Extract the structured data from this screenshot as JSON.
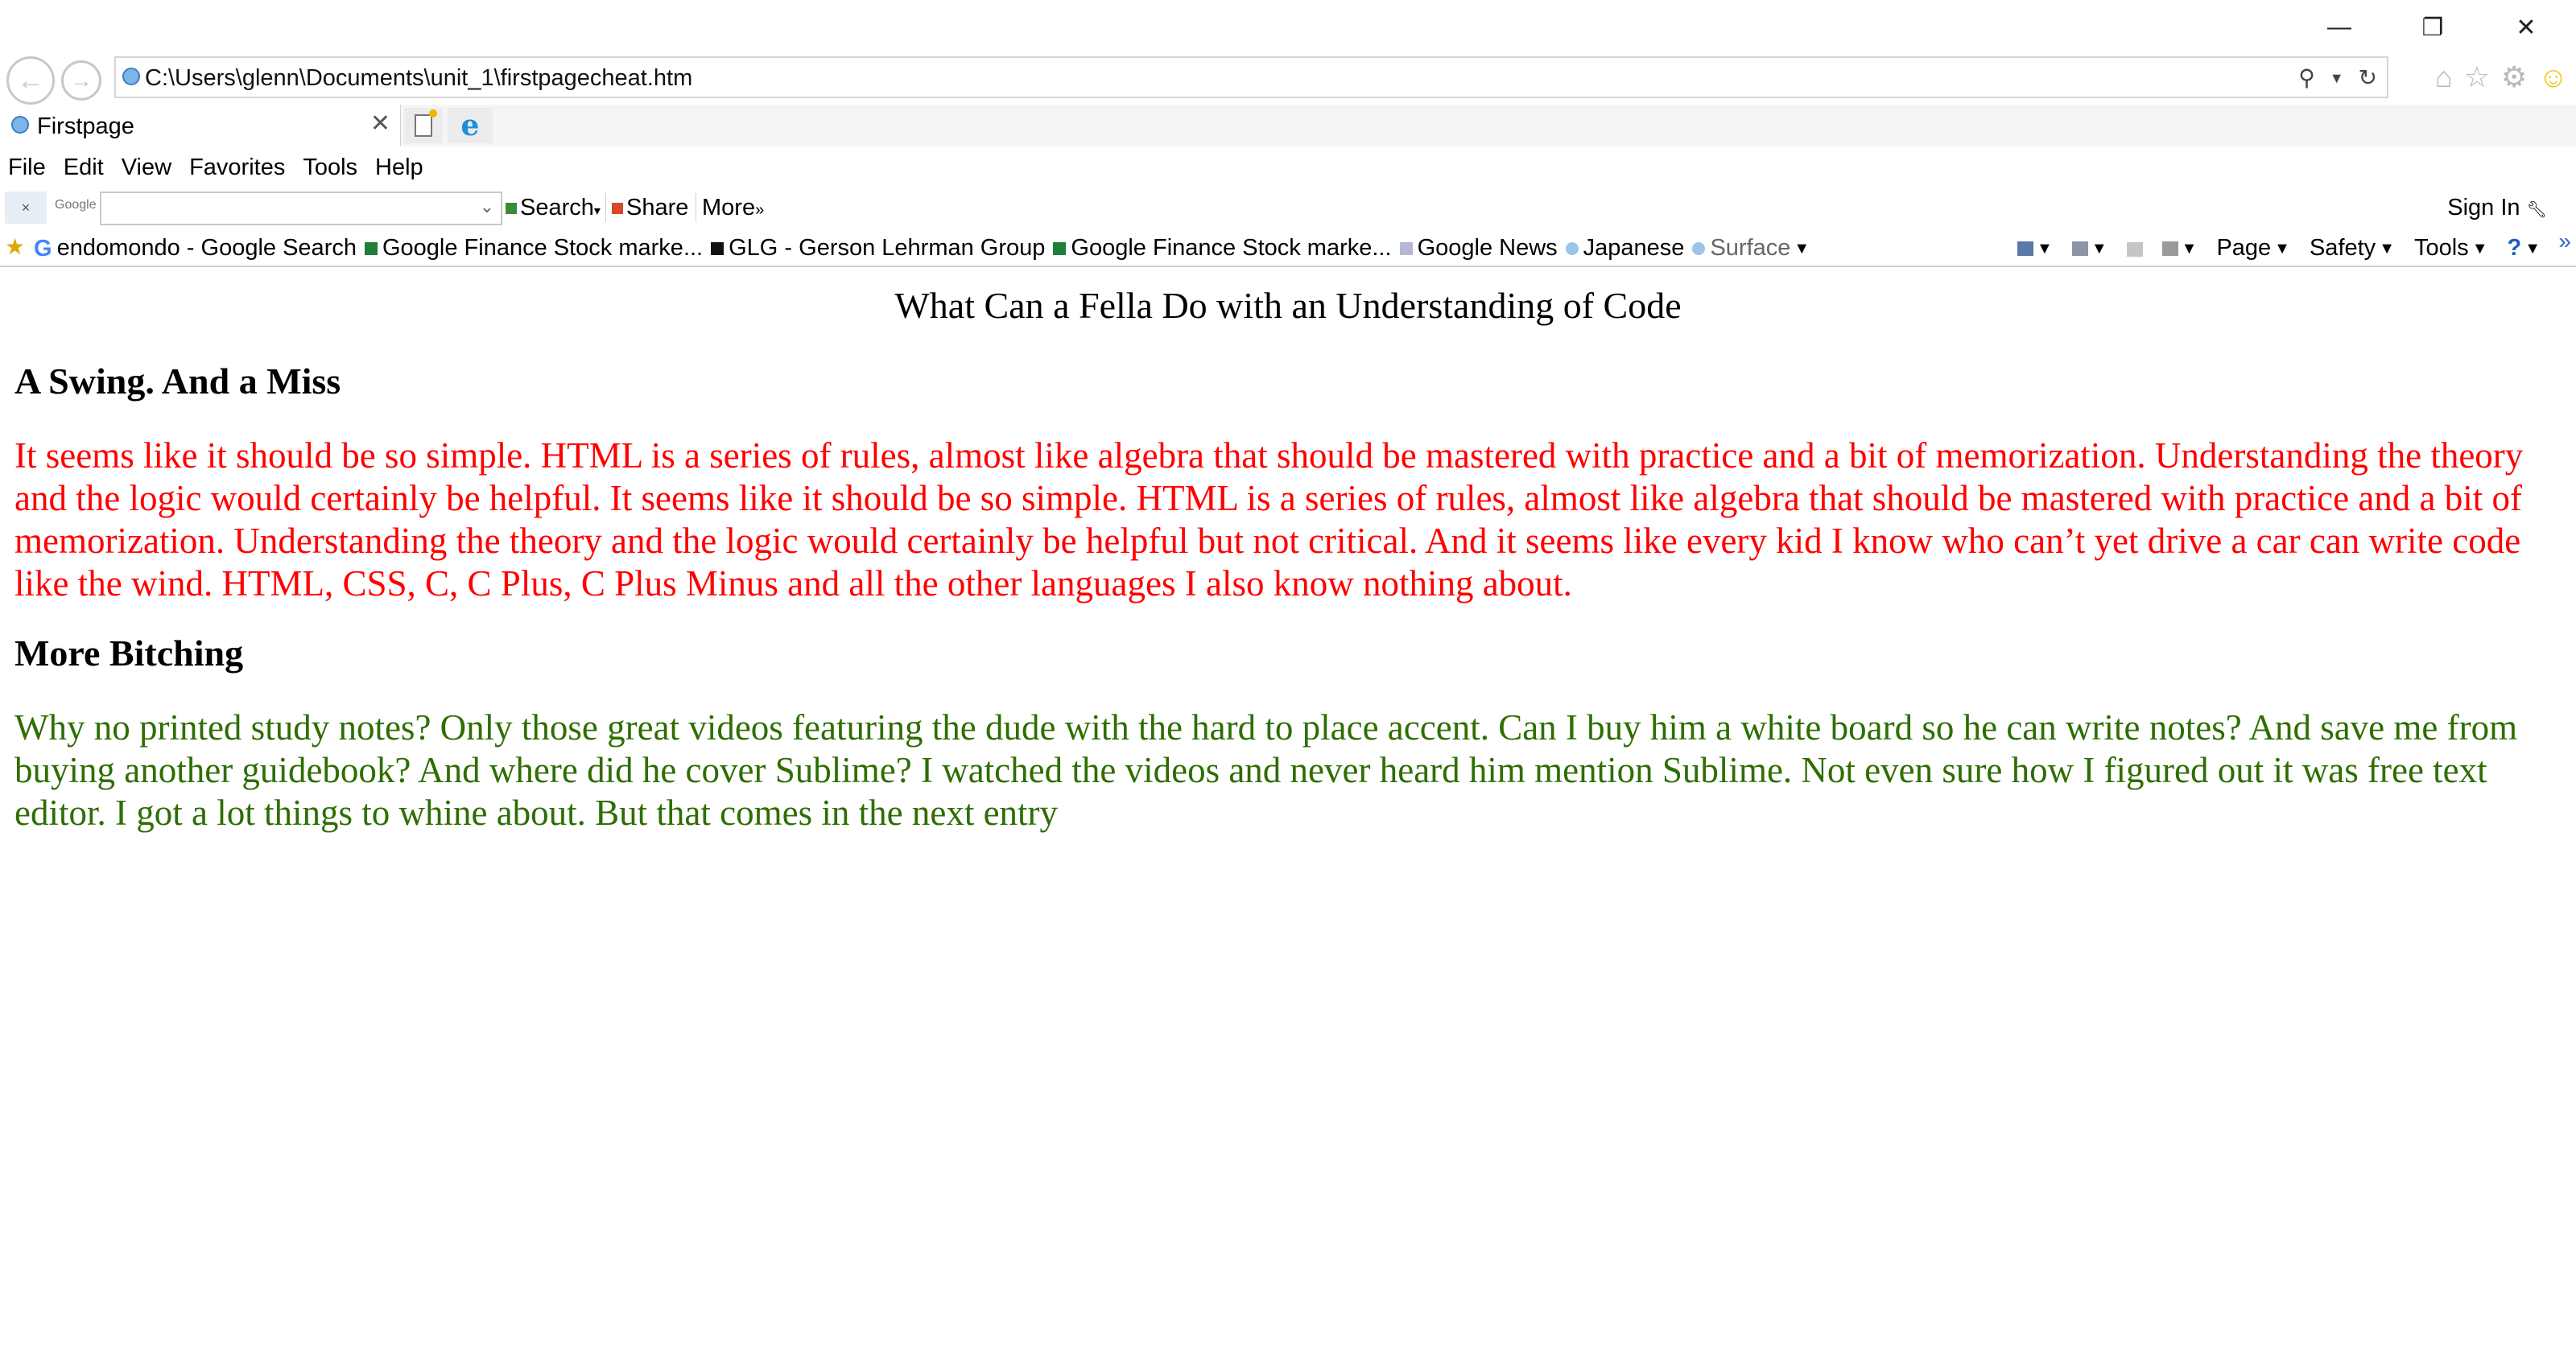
{
  "window": {
    "minimize_glyph": "—",
    "restore_glyph": "❐",
    "close_glyph": "✕"
  },
  "address_bar": {
    "url": "C:\\Users\\glenn\\Documents\\unit_1\\firstpagecheat.htm"
  },
  "tabs": [
    {
      "label": "Firstpage"
    }
  ],
  "menu": [
    "File",
    "Edit",
    "View",
    "Favorites",
    "Tools",
    "Help"
  ],
  "google_toolbar": {
    "logo": "Google",
    "search_label": "Search",
    "share_label": "Share",
    "more_label": "More",
    "sign_in": "Sign In"
  },
  "favorites": [
    {
      "label": "endomondo - Google Search",
      "icon": "google-icon"
    },
    {
      "label": "Google Finance Stock marke...",
      "icon": "finance-icon"
    },
    {
      "label": "GLG - Gerson Lehrman Group",
      "icon": "glg-icon"
    },
    {
      "label": "Google Finance Stock marke...",
      "icon": "finance-icon"
    },
    {
      "label": "Google News",
      "icon": "news-icon"
    },
    {
      "label": "Japanese",
      "icon": "ie-page-icon"
    },
    {
      "label": "Surface",
      "icon": "ie-page-icon"
    }
  ],
  "command_bar": {
    "page": "Page",
    "safety": "Safety",
    "tools": "Tools"
  },
  "content": {
    "title": "What Can a Fella Do with an Understanding of Code",
    "heading1": "A Swing. And a Miss",
    "para1": "It seems like it should be so simple. HTML is a series of rules, almost like algebra that should be mastered with practice and a bit of memorization. Understanding the theory and the logic would certainly be helpful. It seems like it should be so simple. HTML is a series of rules, almost like algebra that should be mastered with practice and a bit of memorization. Understanding the theory and the logic would certainly be helpful but not critical. And it seems like every kid I know who can’t yet drive a car can write code like the wind. HTML, CSS, C, C Plus, C Plus Minus and all the other languages I also know nothing about.",
    "heading2": "More Bitching",
    "para2": "Why no printed study notes? Only those great videos featuring the dude with the hard to place accent. Can I buy him a white board so he can write notes? And save me from buying another guidebook? And where did he cover Sublime? I watched the videos and never heard him mention Sublime. Not even sure how I figured out it was free text editor. I got a lot things to whine about. But that comes in the next entry"
  },
  "colors": {
    "para1": "#ff0000",
    "para2": "#2e6e00"
  }
}
